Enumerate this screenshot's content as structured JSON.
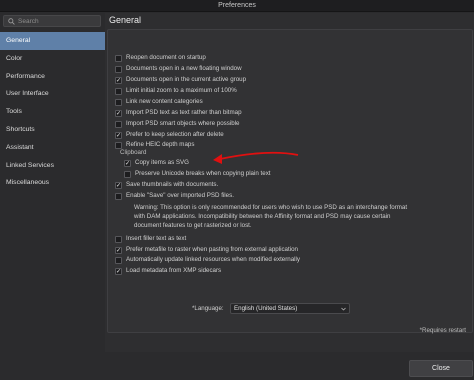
{
  "window": {
    "title": "Preferences"
  },
  "search": {
    "placeholder": "Search"
  },
  "sidebar": {
    "items": [
      {
        "label": "General",
        "active": true
      },
      {
        "label": "Color",
        "active": false
      },
      {
        "label": "Performance",
        "active": false
      },
      {
        "label": "User Interface",
        "active": false
      },
      {
        "label": "Tools",
        "active": false
      },
      {
        "label": "Shortcuts",
        "active": false
      },
      {
        "label": "Assistant",
        "active": false
      },
      {
        "label": "Linked Services",
        "active": false
      },
      {
        "label": "Miscellaneous",
        "active": false
      }
    ]
  },
  "main": {
    "title": "General",
    "options": [
      {
        "label": "Reopen document on startup",
        "checked": false
      },
      {
        "label": "Documents open in a new floating window",
        "checked": false
      },
      {
        "label": "Documents open in the current active group",
        "checked": true
      },
      {
        "label": "Limit initial zoom to a maximum of 100%",
        "checked": false
      },
      {
        "label": "Link new content categories",
        "checked": false
      },
      {
        "label": "Import PSD text as text rather than bitmap",
        "checked": true
      },
      {
        "label": "Import PSD smart objects where possible",
        "checked": false
      },
      {
        "label": "Prefer to keep selection after delete",
        "checked": true
      },
      {
        "label": "Refine HEIC depth maps",
        "checked": false
      }
    ],
    "clipboard_label": "Clipboard",
    "clipboard_options": [
      {
        "label": "Copy items as SVG",
        "checked": true
      },
      {
        "label": "Preserve Unicode breaks when copying plain text",
        "checked": false
      }
    ],
    "options2": [
      {
        "label": "Save thumbnails with documents.",
        "checked": true
      },
      {
        "label": "Enable \"Save\" over imported PSD files.",
        "checked": false
      }
    ],
    "warning_lines": [
      "Warning: This option is only recommended for users who wish to use PSD as an interchange format",
      "with DAM applications. Incompatibility between the Affinity format and PSD may cause certain",
      "document features to get rasterized or lost."
    ],
    "options3": [
      {
        "label": "Insert filler text as text",
        "checked": false
      },
      {
        "label": "Prefer metafile to raster when pasting from external application",
        "checked": true
      },
      {
        "label": "Automatically update linked resources when modified externally",
        "checked": false
      },
      {
        "label": "Load metadata from XMP sidecars",
        "checked": true
      }
    ],
    "language_label": "*Language:",
    "language_value": "English (United States)",
    "requires_restart": "*Requires restart",
    "close_label": "Close"
  },
  "colors": {
    "accent": "#5f80a8",
    "annotation_arrow": "#e01010"
  },
  "icons": {
    "search": "search-icon",
    "dropdown": "chevron-down-icon",
    "check": "checkmark-icon"
  }
}
